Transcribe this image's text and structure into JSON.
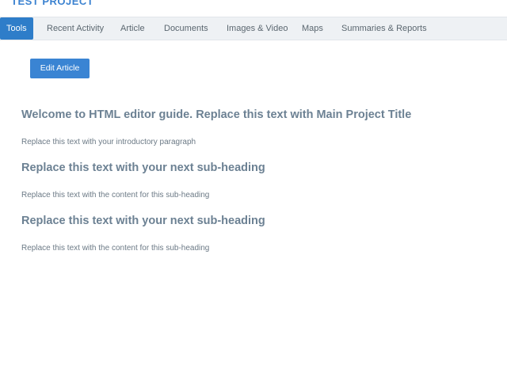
{
  "header": {
    "project_title": "TEST PROJECT"
  },
  "tabs": [
    {
      "label": "Tools",
      "active": true
    },
    {
      "label": "Recent Activity",
      "active": false
    },
    {
      "label": "Article",
      "active": false
    },
    {
      "label": "Documents",
      "active": false
    },
    {
      "label": "Images & Video",
      "active": false
    },
    {
      "label": "Maps",
      "active": false
    },
    {
      "label": "Summaries & Reports",
      "active": false
    }
  ],
  "toolbar": {
    "edit_label": "Edit Article"
  },
  "article": {
    "title": "Welcome to HTML editor guide. Replace this text with Main Project Title",
    "intro": "Replace this text with your introductory paragraph",
    "sections": [
      {
        "heading": "Replace this text with your next sub-heading",
        "content": "Replace this text with the content for this sub-heading"
      },
      {
        "heading": "Replace this text with your next sub-heading",
        "content": "Replace this text with the content for this sub-heading"
      }
    ]
  },
  "colors": {
    "accent": "#2e7dc9",
    "heading": "#6c8193",
    "tabbar_bg": "#eef1f4"
  }
}
